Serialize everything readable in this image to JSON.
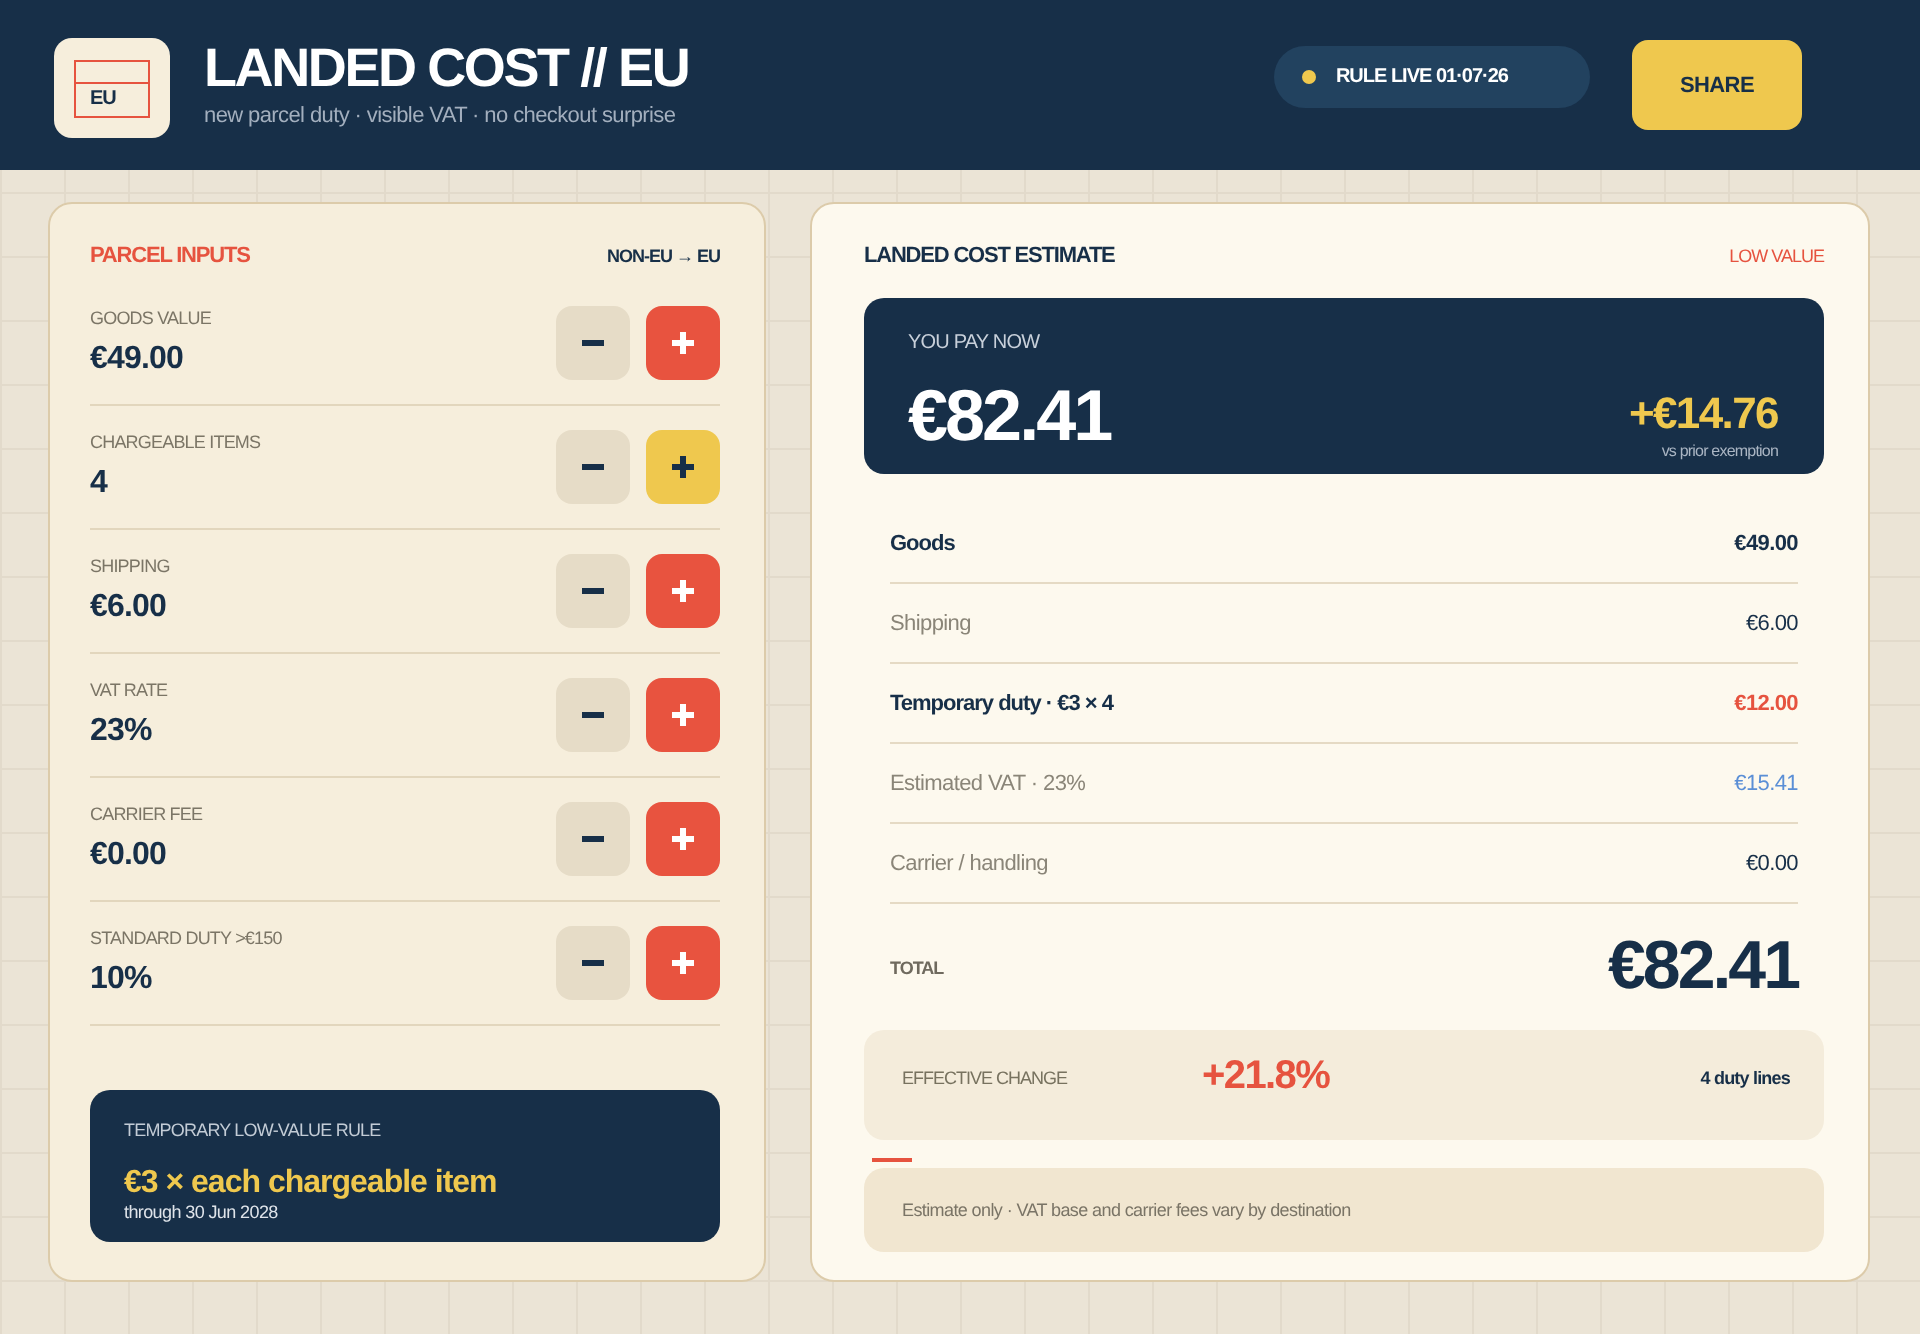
{
  "header": {
    "logo_text": "EU",
    "title": "LANDED COST // EU",
    "subtitle": "new parcel duty · visible VAT · no checkout surprise",
    "status": "RULE LIVE 01·07·26",
    "share_button": "SHARE"
  },
  "inputs": {
    "title": "PARCEL INPUTS",
    "route": "NON-EU → EU",
    "rows": [
      {
        "label": "GOODS VALUE",
        "value": "€49.00",
        "highlighted": false
      },
      {
        "label": "CHARGEABLE ITEMS",
        "value": "4",
        "highlighted": true
      },
      {
        "label": "SHIPPING",
        "value": "€6.00",
        "highlighted": false
      },
      {
        "label": "VAT RATE",
        "value": "23%",
        "highlighted": false
      },
      {
        "label": "CARRIER FEE",
        "value": "€0.00",
        "highlighted": false
      },
      {
        "label": "STANDARD DUTY >€150",
        "value": "10%",
        "highlighted": false
      }
    ],
    "rule": {
      "label": "TEMPORARY LOW-VALUE RULE",
      "headline": "€3 × each chargeable item",
      "note": "through 30 Jun 2028"
    }
  },
  "estimate": {
    "title": "LANDED COST ESTIMATE",
    "badge": "LOW VALUE",
    "pay_label": "YOU PAY NOW",
    "pay_amount": "€82.41",
    "delta": "+€14.76",
    "delta_note": "vs prior exemption",
    "lines": [
      {
        "label": "Goods",
        "value": "€49.00",
        "emphasis": true,
        "color": "#172f48"
      },
      {
        "label": "Shipping",
        "value": "€6.00",
        "emphasis": false,
        "color": "#172f48"
      },
      {
        "label": "Temporary duty · €3 × 4",
        "value": "€12.00",
        "emphasis": true,
        "color": "#e6533f"
      },
      {
        "label": "Estimated VAT · 23%",
        "value": "€15.41",
        "emphasis": false,
        "color": "#5b8fd6"
      },
      {
        "label": "Carrier / handling",
        "value": "€0.00",
        "emphasis": false,
        "color": "#172f48"
      }
    ],
    "total_label": "TOTAL",
    "total": "€82.41",
    "change_label": "EFFECTIVE CHANGE",
    "change": "+21.8%",
    "duty_lines": "4 duty lines",
    "note": "Estimate only · VAT base and carrier fees vary by destination"
  }
}
